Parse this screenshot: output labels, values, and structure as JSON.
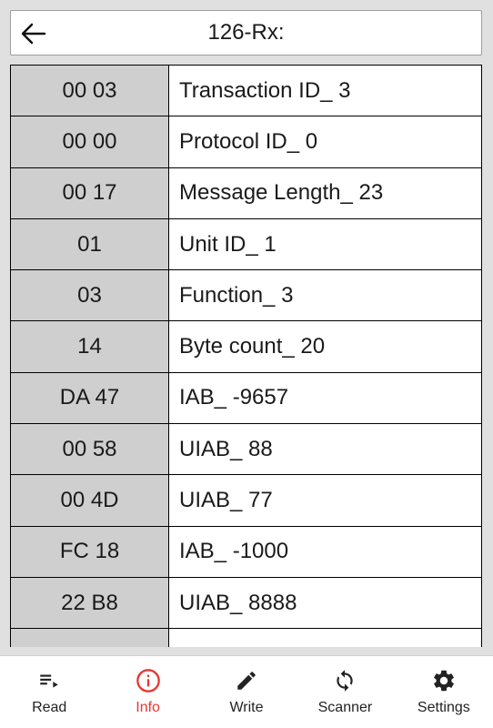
{
  "header": {
    "title": "126-Rx:"
  },
  "table": {
    "rows": [
      {
        "hex": "00 03",
        "desc": "Transaction ID_ 3"
      },
      {
        "hex": "00 00",
        "desc": "Protocol ID_ 0"
      },
      {
        "hex": "00 17",
        "desc": "Message Length_ 23"
      },
      {
        "hex": "01",
        "desc": "Unit ID_ 1"
      },
      {
        "hex": "03",
        "desc": "Function_ 3"
      },
      {
        "hex": "14",
        "desc": "Byte count_ 20"
      },
      {
        "hex": "DA 47",
        "desc": "IAB_ -9657"
      },
      {
        "hex": "00 58",
        "desc": "UIAB_ 88"
      },
      {
        "hex": "00 4D",
        "desc": "UIAB_ 77"
      },
      {
        "hex": "FC 18",
        "desc": "IAB_ -1000"
      },
      {
        "hex": "22 B8",
        "desc": "UIAB_ 8888"
      },
      {
        "hex": "",
        "desc": ""
      }
    ]
  },
  "nav": {
    "items": [
      {
        "label": "Read",
        "icon": "read-list-icon"
      },
      {
        "label": "Info",
        "icon": "info-icon"
      },
      {
        "label": "Write",
        "icon": "pencil-icon"
      },
      {
        "label": "Scanner",
        "icon": "sync-icon"
      },
      {
        "label": "Settings",
        "icon": "gear-icon"
      }
    ],
    "active_color": "#e53935"
  }
}
